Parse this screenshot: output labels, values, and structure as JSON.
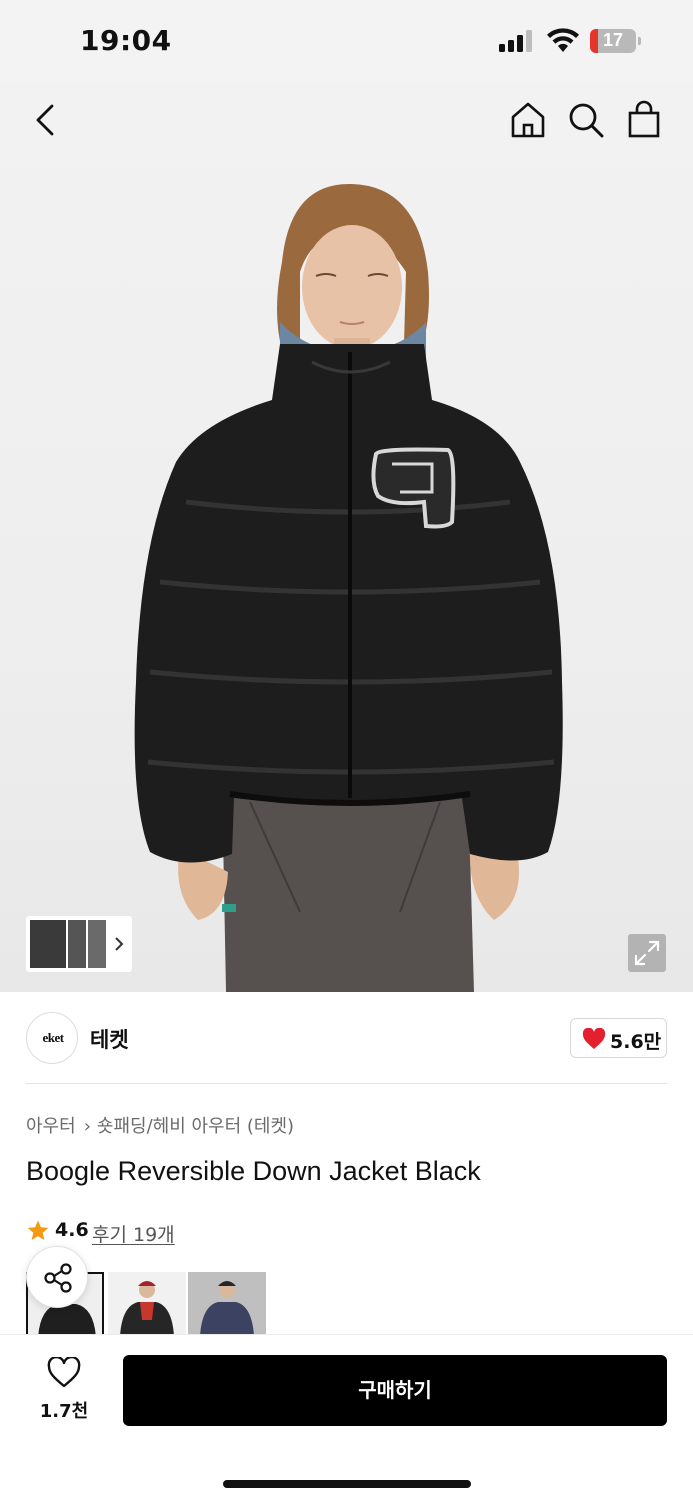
{
  "status_bar": {
    "time": "19:04",
    "battery_level": "17",
    "battery_fraction": 0.17,
    "signal_icon": "cellular-signal-icon",
    "wifi_icon": "wifi-icon",
    "battery_icon": "battery-icon"
  },
  "nav": {
    "back_icon": "chevron-left-icon",
    "home_icon": "home-icon",
    "search_icon": "search-icon",
    "bag_icon": "shopping-bag-icon"
  },
  "gallery": {
    "image": "model wearing black puffer jacket",
    "thumbnail_strip_icon": "chevron-right-icon",
    "expand_icon": "expand-icon"
  },
  "brand": {
    "logo_text": "eket",
    "name": "테켓",
    "like_count": "5.6만",
    "like_color": "#e5202e"
  },
  "product": {
    "breadcrumb": [
      "아우터",
      "숏패딩/헤비 아우터 (테켓)"
    ],
    "breadcrumb_separator": "›",
    "title": "Boogle Reversible Down Jacket Black",
    "rating": "4.6",
    "reviews": "후기 19개",
    "star_color": "#f39a12",
    "color_options": [
      "Black",
      "Red",
      "Navy"
    ]
  },
  "bottom_bar": {
    "wish_count": "1.7천",
    "buy_label": "구매하기"
  },
  "colors": {
    "accent": "#000000",
    "heart_red": "#e5202e",
    "star_orange": "#f39a12"
  }
}
